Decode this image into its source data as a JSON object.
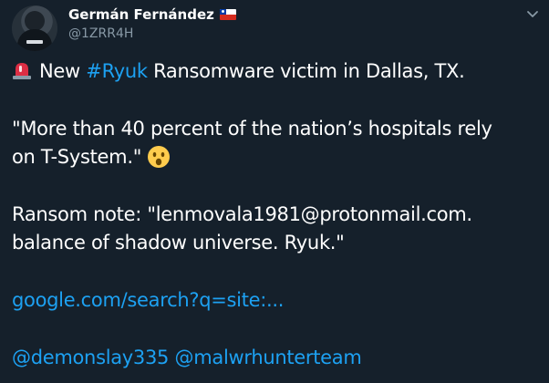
{
  "user": {
    "display_name": "Germán Fernández",
    "handle": "@1ZRR4H",
    "flag_icon": "chile-flag-icon"
  },
  "tweet": {
    "line1_text": "New ",
    "line1_hashtag": "#Ryuk",
    "line1_rest": " Ransomware victim in Dallas, TX.",
    "quote_line1": "\"More than 40 percent of the nation’s hospitals rely",
    "quote_line2": "on T-System.\"",
    "note_line1": "Ransom note: \"lenmovala1981@protonmail.com.",
    "note_line2": "balance of shadow universe. Ryuk.\"",
    "link_text": "google.com/search?q=site:...",
    "mention1": "@demonslay335",
    "mention2": "@malwrhunterteam"
  },
  "colors": {
    "background": "#15202b",
    "link": "#1da1f2",
    "secondary_text": "#8899a6"
  },
  "icons": {
    "siren": "siren-emoji-icon",
    "surprised": "surprised-face-emoji-icon",
    "menu": "chevron-down-icon"
  }
}
